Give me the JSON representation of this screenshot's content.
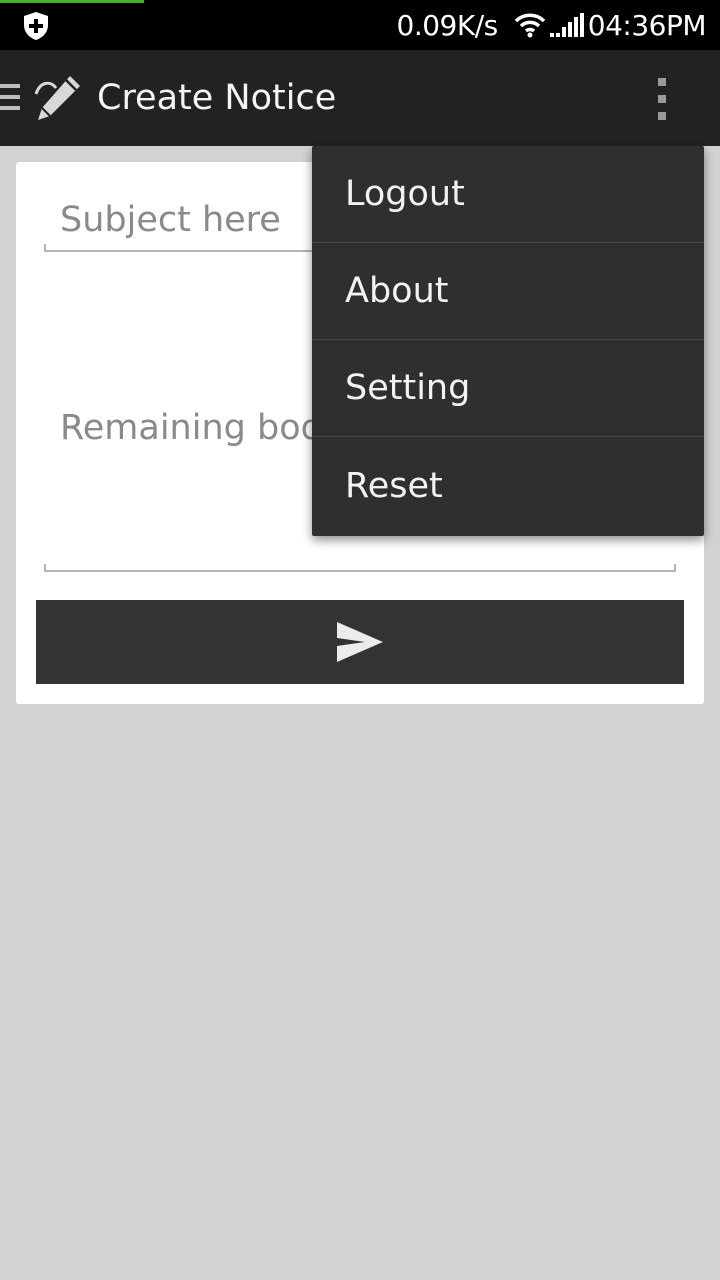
{
  "status_bar": {
    "network_speed": "0.09K/s",
    "time": "04:36PM",
    "icons": [
      "shield-plus-icon",
      "wifi-icon",
      "signal-icon"
    ]
  },
  "action_bar": {
    "title": "Create Notice",
    "icons": [
      "drawer-menu-icon",
      "pen-icon",
      "overflow-menu-icon"
    ],
    "background": "#222222"
  },
  "form": {
    "subject_placeholder": "Subject here",
    "body_placeholder": "Remaining body",
    "send_icon": "send-icon",
    "send_button_color": "#333333"
  },
  "menu": {
    "items": [
      {
        "label": "Logout"
      },
      {
        "label": "About"
      },
      {
        "label": "Setting"
      },
      {
        "label": "Reset"
      }
    ],
    "background": "#2f2f2f"
  },
  "colors": {
    "page_background": "#d2d2d2",
    "progress_accent": "#45b21f"
  }
}
